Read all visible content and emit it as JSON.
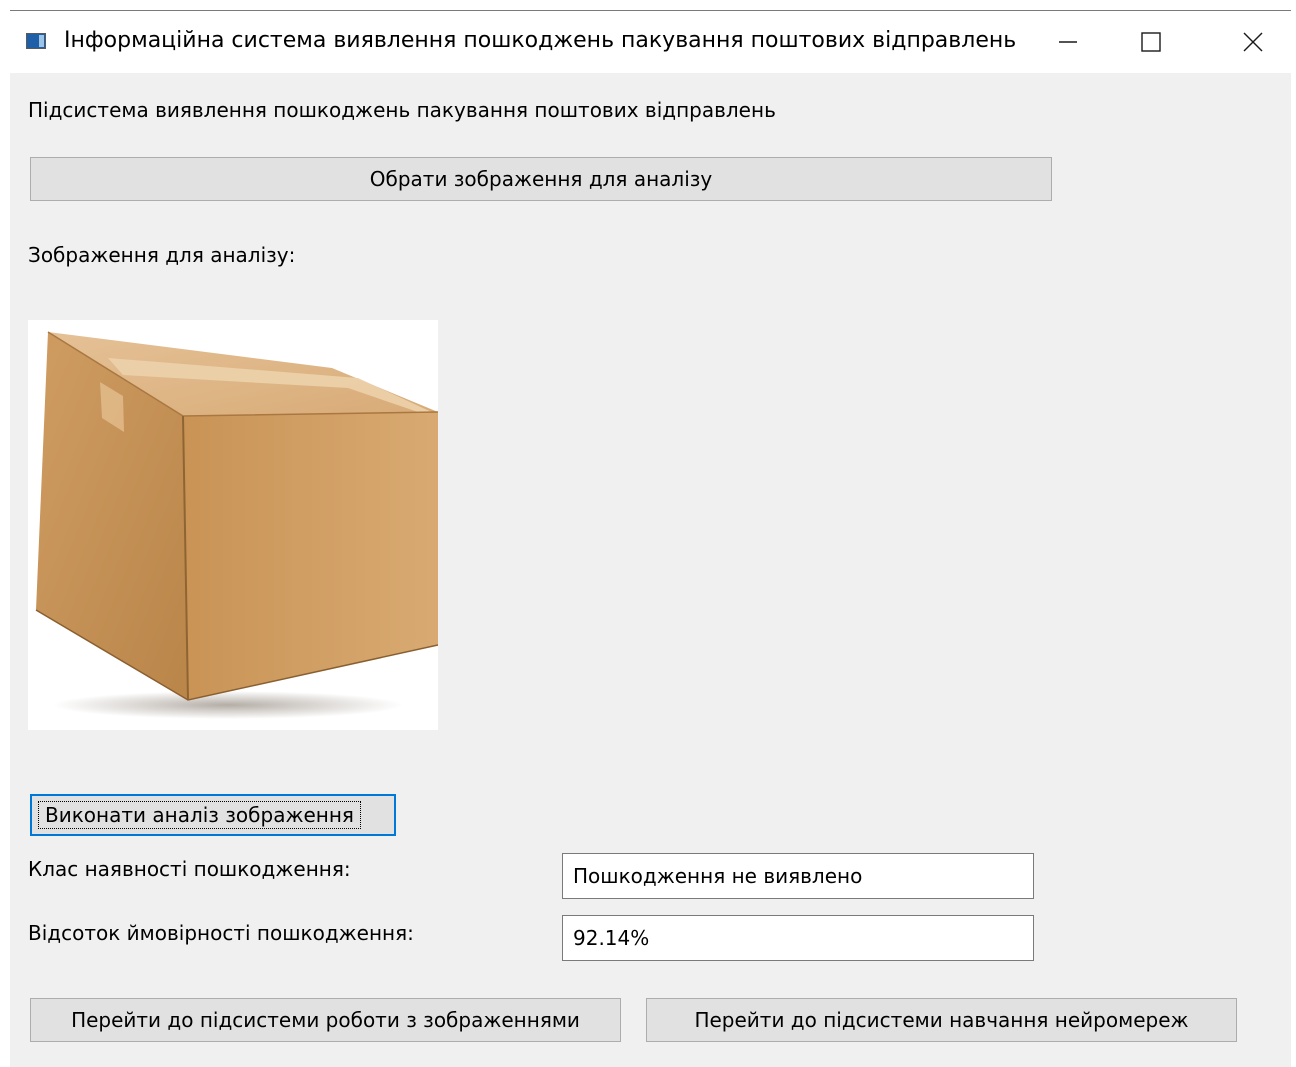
{
  "window": {
    "title": "Інформаційна система виявлення пошкоджень пакування поштових відправлень",
    "icon": "app-window-icon",
    "controls": [
      "minimize-icon",
      "maximize-icon",
      "close-icon"
    ]
  },
  "main": {
    "heading": "Підсистема виявлення пошкоджень пакування поштових відправлень",
    "select_image_button": "Обрати зображення для аналізу",
    "image_label": "Зображення для аналізу:",
    "image_content": "cardboard-box-photo",
    "analyze_button": "Виконати аналіз зображення",
    "damage_class_label": "Клас наявності пошкодження:",
    "damage_class_value": "Пошкодження не виявлено",
    "probability_label": "Відсоток ймовірності пошкодження:",
    "probability_value": "92.14%",
    "goto_images_button": "Перейти до підсистеми роботи з зображеннями",
    "goto_training_button": "Перейти до підсистеми навчання нейромереж"
  },
  "colors": {
    "window_background": "#f0f0f0",
    "button_face": "#e1e1e1",
    "focus_border": "#0078d7",
    "box_cardboard": "#d1a26a"
  }
}
